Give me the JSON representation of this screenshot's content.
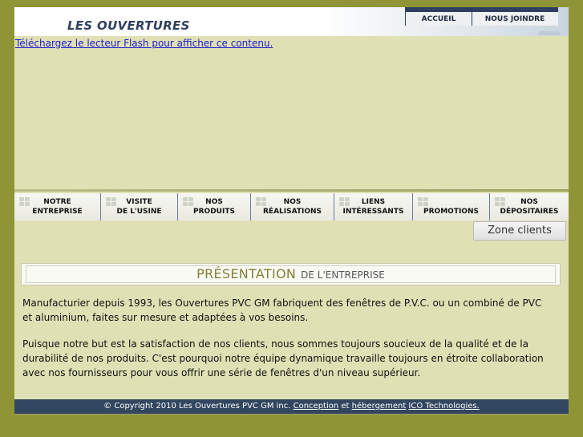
{
  "header": {
    "site_title": "LES OUVERTURES",
    "top_nav": [
      "ACCUEIL",
      "NOUS JOINDRE"
    ]
  },
  "flash": {
    "link_text": "Téléchargez le lecteur Flash pour afficher ce contenu."
  },
  "main_nav": [
    {
      "label": "NOTRE\nENTREPRISE"
    },
    {
      "label": "VISITE\nDE L'USINE"
    },
    {
      "label": "NOS\nPRODUITS"
    },
    {
      "label": "NOS\nRÉALISATIONS"
    },
    {
      "label": "LIENS\nINTÉRESSANTS"
    },
    {
      "label": "PROMOTIONS"
    },
    {
      "label": "NOS\nDÉPOSITAIRES"
    }
  ],
  "zone_clients": "Zone clients",
  "section": {
    "title": "PRÉSENTATION",
    "subtitle": "DE L'ENTREPRISE"
  },
  "content": {
    "para_1": "Manufacturier depuis 1993, les Ouvertures PVC GM fabriquent des fenêtres de P.V.C. ou un combiné de PVC et aluminium, faites sur mesure et adaptées à vos besoins.",
    "para_2": "Puisque notre but est la satisfaction de nos clients, nous sommes toujours soucieux de la qualité et de la durabilité de nos produits. C'est pourquoi notre équipe dynamique travaille toujours en étroite collaboration avec nos fournisseurs pour vous offrir une série de fenêtres d'un niveau supérieur."
  },
  "footer": {
    "copyright": "© Copyright 2010 Les Ouvertures PVC GM inc.",
    "conception": "Conception",
    "et": "et",
    "hebergement": "hébergement",
    "company": "ICO Technologies."
  },
  "colors": {
    "background": "#8f9536",
    "page": "#dfe0b4",
    "footer": "#32465f",
    "accent_title": "#7f8032"
  }
}
